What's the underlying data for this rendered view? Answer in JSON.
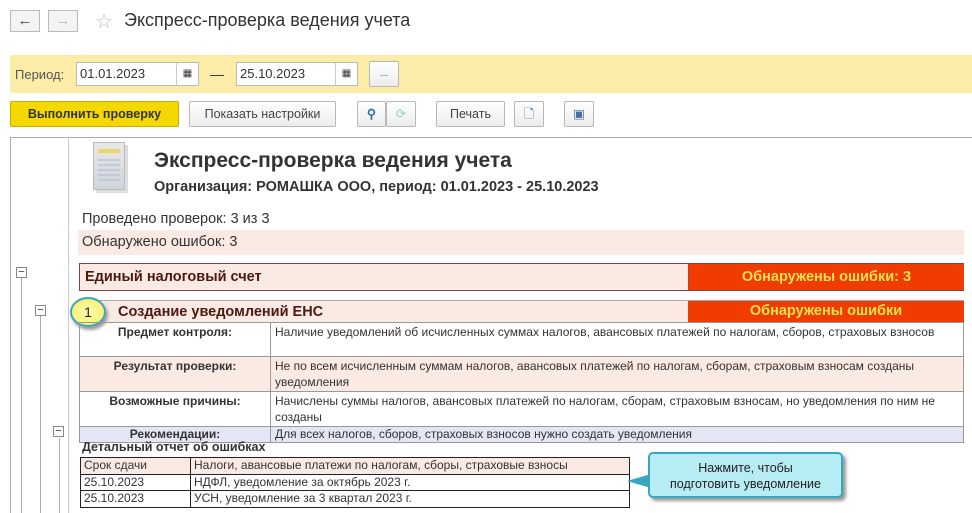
{
  "window": {
    "title": "Экспресс-проверка ведения учета",
    "back_icon": "arrow-left-icon",
    "forward_icon": "arrow-right-icon",
    "favorite_icon": "star-icon"
  },
  "period": {
    "label": "Период:",
    "from": "01.01.2023",
    "to": "25.10.2023",
    "dash": "—",
    "more": "..."
  },
  "toolbar": {
    "run": "Выполнить проверку",
    "settings": "Показать настройки",
    "print": "Печать"
  },
  "report": {
    "title": "Экспресс-проверка ведения учета",
    "subtitle": "Организация: РОМАШКА ООО, период: 01.01.2023 - 25.10.2023",
    "checks_done": "Проведено проверок: 3 из 3",
    "errors_found": "Обнаружено ошибок: 3",
    "section": {
      "title": "Единый налоговый счет",
      "status": "Обнаружены ошибки: 3"
    },
    "check": {
      "number": "1",
      "title": "Создание уведомлений ЕНС",
      "status": "Обнаружены ошибки",
      "rows": [
        {
          "label": "Предмет контроля:",
          "value": "Наличие уведомлений об исчисленных суммах налогов, авансовых платежей по налогам, сборов, страховых взносов"
        },
        {
          "label": "Результат проверки:",
          "value": "Не по всем исчисленным суммам налогов, авансовых платежей по налогам, сборам, страховым взносам созданы уведомления"
        },
        {
          "label": "Возможные причины:",
          "value": "Начислены суммы налогов, авансовых платежей по налогам, сборам, страховым взносам, но уведомления по ним не созданы"
        },
        {
          "label": "Рекомендации:",
          "value": "Для всех налогов, сборов, страховых взносов нужно создать уведомления"
        }
      ]
    },
    "detail": {
      "title": "Детальный отчет об ошибках",
      "headers": [
        "Срок сдачи",
        "Налоги, авансовые платежи по налогам, сборы, страховые взносы"
      ],
      "rows": [
        [
          "25.10.2023",
          "НДФЛ, уведомление за октябрь 2023 г."
        ],
        [
          "25.10.2023",
          "УСН, уведомление за 3 квартал 2023 г."
        ]
      ]
    },
    "callout": "Нажмите, чтобы подготовить уведомление"
  },
  "colors": {
    "accent_yellow": "#f5d800",
    "period_bar": "#fbeca8",
    "error_red": "#f03c00",
    "error_text": "#ffe14a",
    "pink_row": "#fbe9e4",
    "recommend_row": "#e4e6f6",
    "callout": "#b8ecf4"
  }
}
